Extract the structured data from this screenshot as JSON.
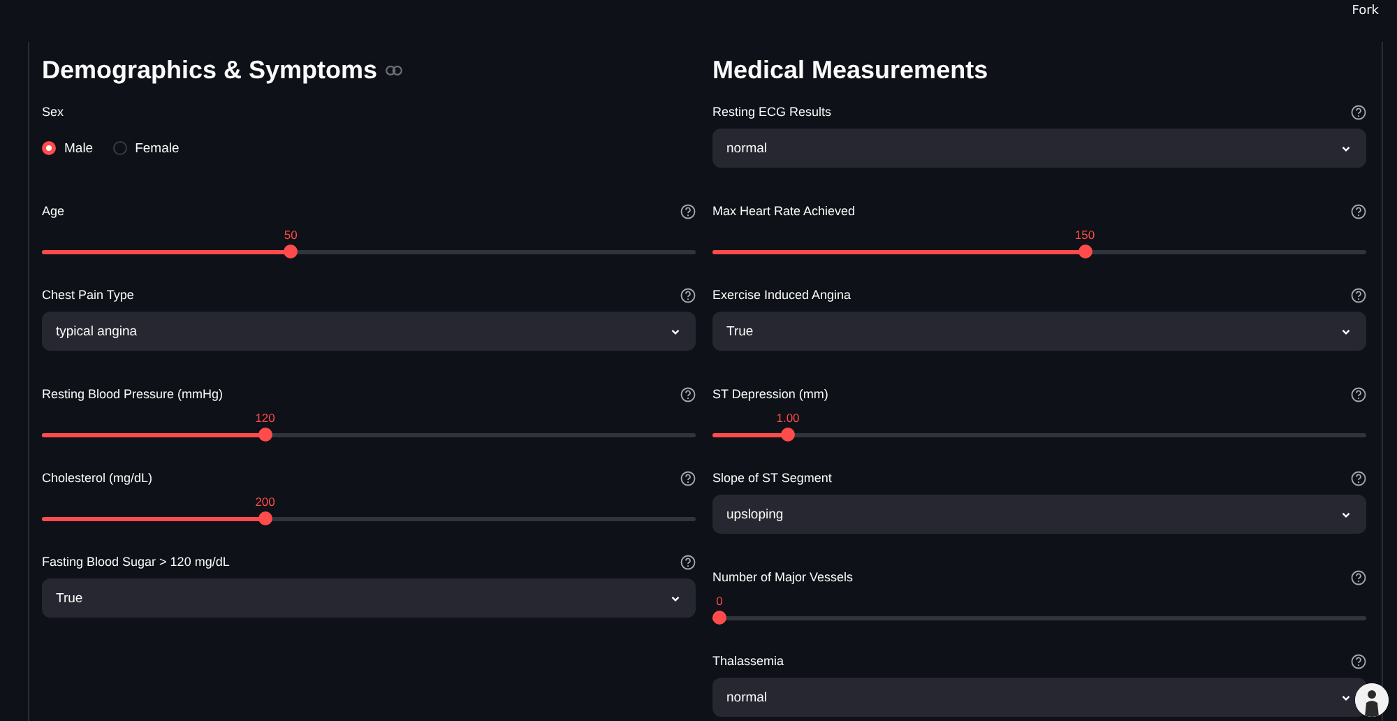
{
  "header": {
    "fork_label": "Fork"
  },
  "columns": [
    {
      "title": "Demographics & Symptoms",
      "link_anchor": true,
      "fields": [
        {
          "kind": "radio",
          "label": "Sex",
          "help": false,
          "options": [
            {
              "label": "Male",
              "selected": true
            },
            {
              "label": "Female",
              "selected": false
            }
          ]
        },
        {
          "kind": "slider",
          "label": "Age",
          "help": true,
          "value": "50",
          "level": 0.378
        },
        {
          "kind": "select",
          "label": "Chest Pain Type",
          "help": true,
          "value": "typical angina"
        },
        {
          "kind": "slider",
          "label": "Resting Blood Pressure (mmHg)",
          "help": true,
          "value": "120",
          "level": 0.338
        },
        {
          "kind": "slider",
          "label": "Cholesterol (mg/dL)",
          "help": true,
          "value": "200",
          "level": 0.338
        },
        {
          "kind": "select",
          "label": "Fasting Blood Sugar > 120 mg/dL",
          "help": true,
          "value": "True"
        }
      ]
    },
    {
      "title": "Medical Measurements",
      "link_anchor": false,
      "fields": [
        {
          "kind": "select",
          "label": "Resting ECG Results",
          "help": true,
          "value": "normal"
        },
        {
          "kind": "slider",
          "label": "Max Heart Rate Achieved",
          "help": true,
          "value": "150",
          "level": 0.571
        },
        {
          "kind": "select",
          "label": "Exercise Induced Angina",
          "help": true,
          "value": "True"
        },
        {
          "kind": "slider",
          "label": "ST Depression (mm)",
          "help": true,
          "value": "1.00",
          "level": 0.107
        },
        {
          "kind": "select",
          "label": "Slope of ST Segment",
          "help": true,
          "value": "upsloping"
        },
        {
          "kind": "slider",
          "label": "Number of Major Vessels",
          "help": true,
          "value": "0",
          "level": 0
        },
        {
          "kind": "select",
          "label": "Thalassemia",
          "help": true,
          "value": "normal"
        }
      ]
    }
  ]
}
